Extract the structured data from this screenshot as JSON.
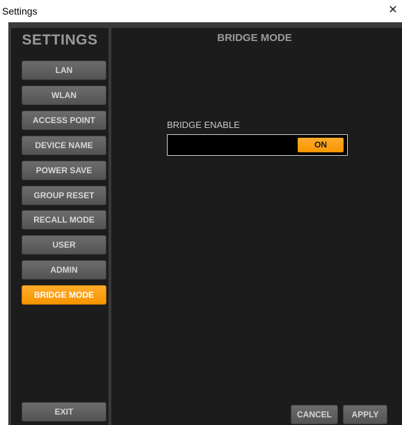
{
  "window": {
    "title": "Settings",
    "close_glyph": "✕"
  },
  "sidebar": {
    "title": "SETTINGS",
    "items": [
      {
        "label": "LAN",
        "active": false
      },
      {
        "label": "WLAN",
        "active": false
      },
      {
        "label": "ACCESS POINT",
        "active": false
      },
      {
        "label": "DEVICE NAME",
        "active": false
      },
      {
        "label": "POWER SAVE",
        "active": false
      },
      {
        "label": "GROUP RESET",
        "active": false
      },
      {
        "label": "RECALL MODE",
        "active": false
      },
      {
        "label": "USER",
        "active": false
      },
      {
        "label": "ADMIN",
        "active": false
      },
      {
        "label": "BRIDGE MODE",
        "active": true
      }
    ],
    "exit_label": "EXIT"
  },
  "main": {
    "title": "BRIDGE MODE",
    "bridge_enable": {
      "label": "BRIDGE ENABLE",
      "value": "ON"
    },
    "cancel_label": "CANCEL",
    "apply_label": "APPLY"
  },
  "colors": {
    "accent": "#f7a11a",
    "panel_background": "#1c1c1c",
    "button_gray": "#5f5f5f"
  },
  "icons": {
    "close": "close-icon"
  }
}
